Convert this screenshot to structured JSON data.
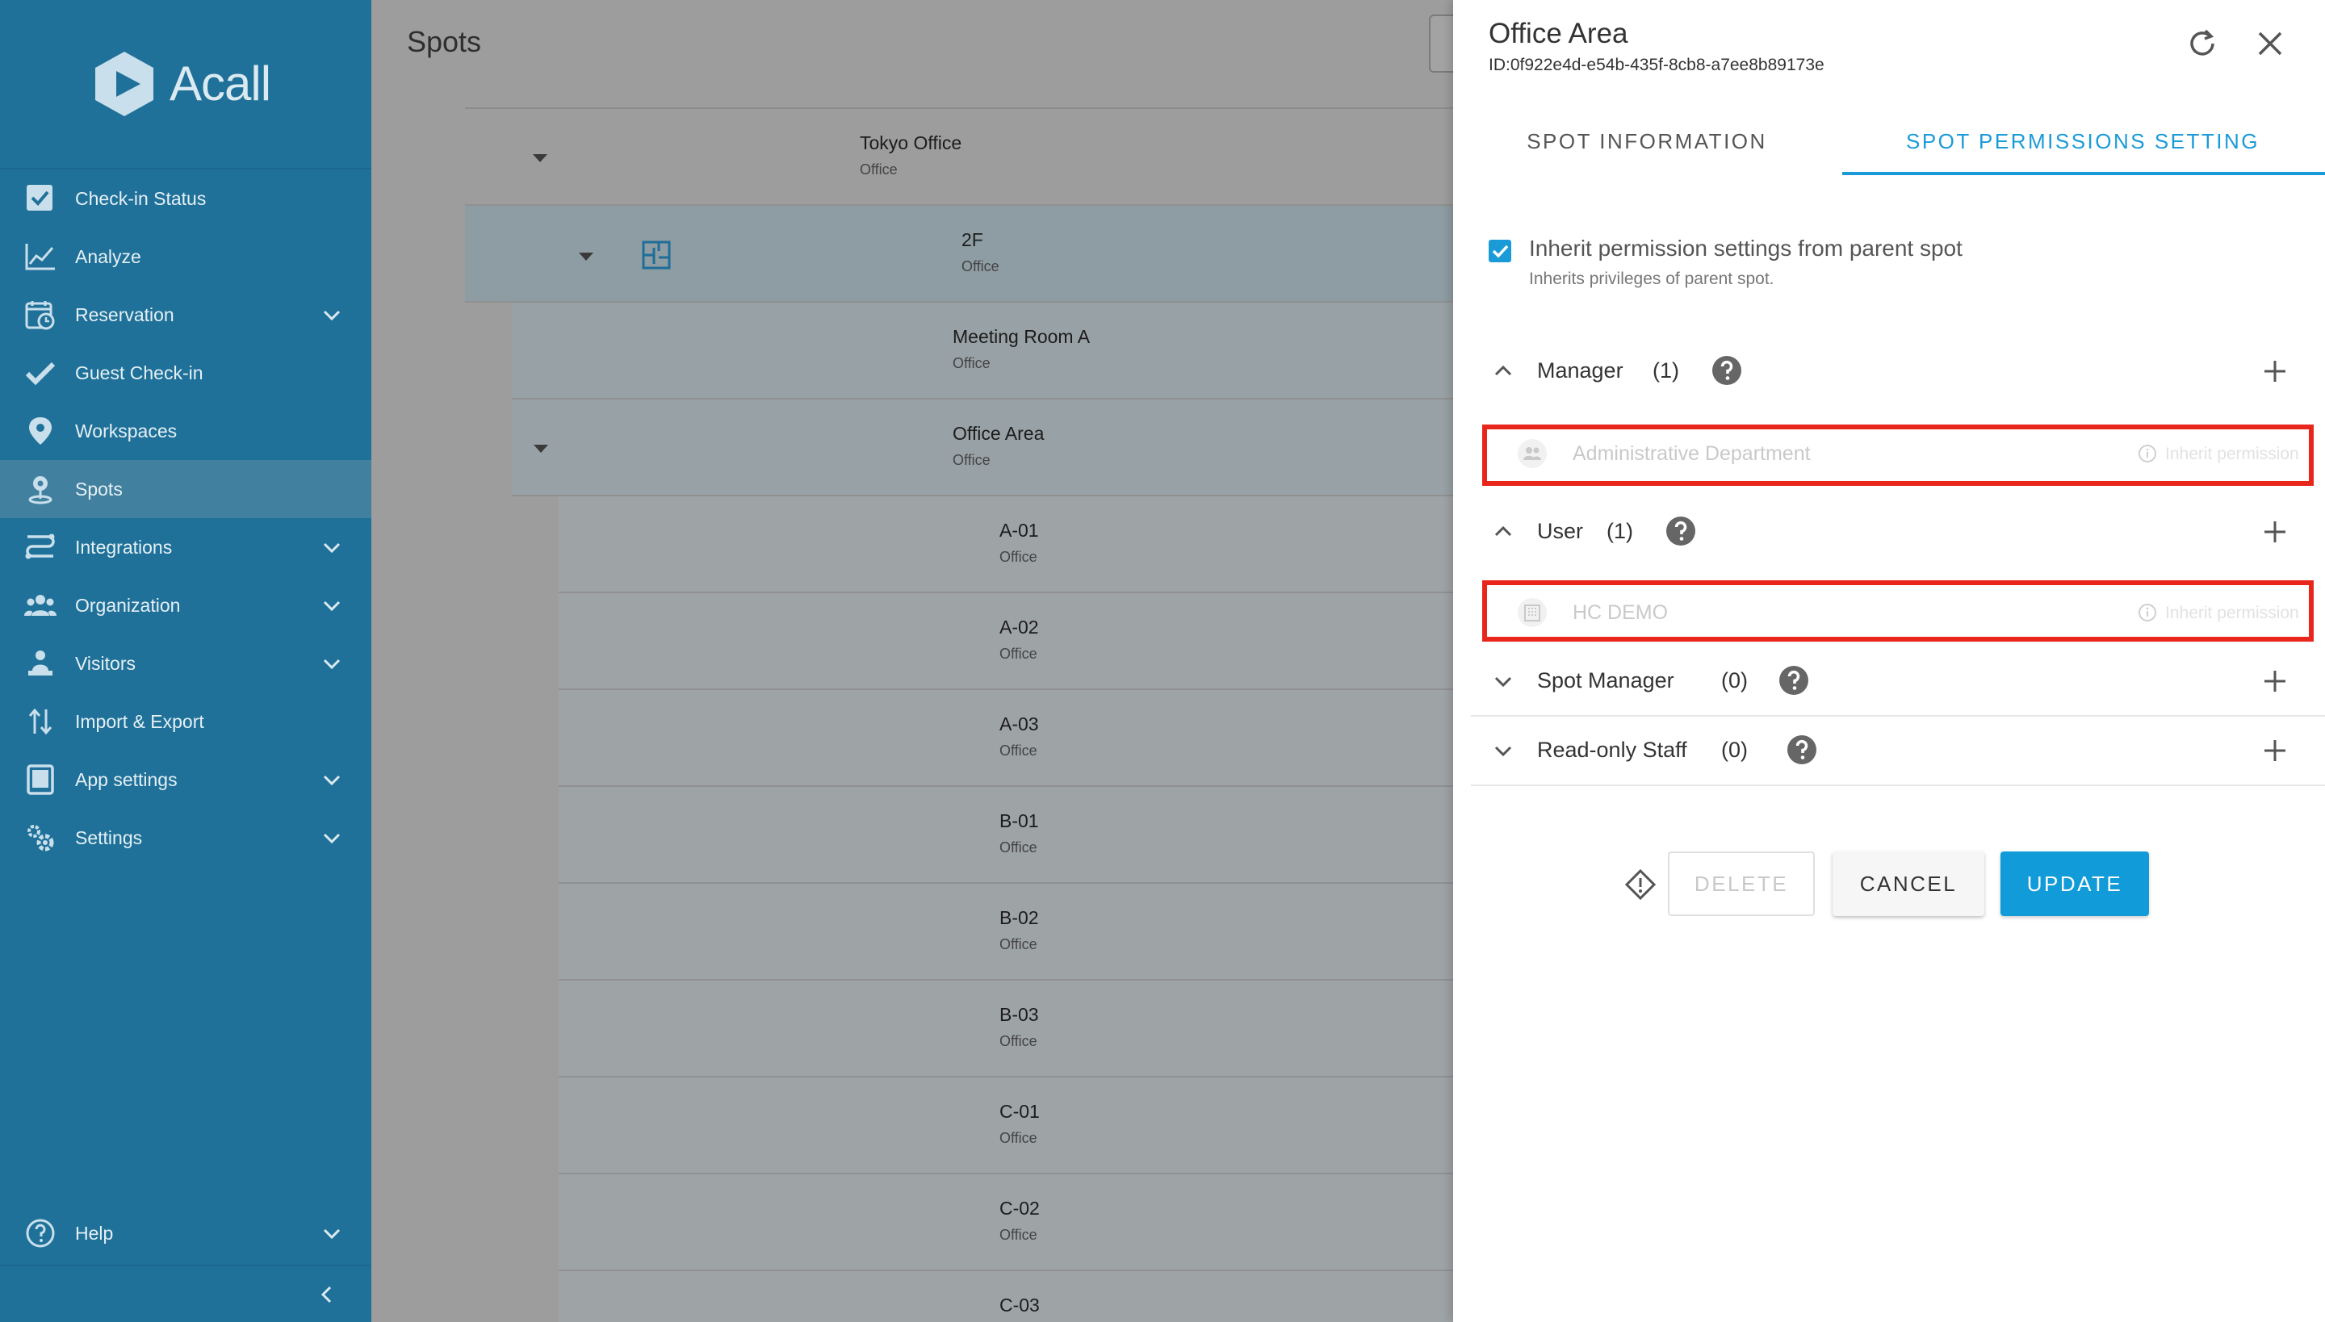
{
  "brand": {
    "name": "Acall"
  },
  "sidebar": {
    "items": [
      {
        "label": "Check-in Status",
        "icon": "check-square-icon",
        "has_submenu": false
      },
      {
        "label": "Analyze",
        "icon": "line-chart-icon",
        "has_submenu": false
      },
      {
        "label": "Reservation",
        "icon": "calendar-clock-icon",
        "has_submenu": true
      },
      {
        "label": "Guest Check-in",
        "icon": "checkmark-icon",
        "has_submenu": false
      },
      {
        "label": "Workspaces",
        "icon": "map-pin-icon",
        "has_submenu": false
      },
      {
        "label": "Spots",
        "icon": "spot-pin-icon",
        "has_submenu": false,
        "active": true
      },
      {
        "label": "Integrations",
        "icon": "integrations-icon",
        "has_submenu": true
      },
      {
        "label": "Organization",
        "icon": "people-group-icon",
        "has_submenu": true
      },
      {
        "label": "Visitors",
        "icon": "visitor-icon",
        "has_submenu": true
      },
      {
        "label": "Import & Export",
        "icon": "import-export-icon",
        "has_submenu": false
      },
      {
        "label": "App settings",
        "icon": "tablet-icon",
        "has_submenu": true
      },
      {
        "label": "Settings",
        "icon": "gears-icon",
        "has_submenu": true
      }
    ],
    "help": {
      "label": "Help",
      "icon": "help-circle-icon"
    }
  },
  "main": {
    "title": "Spots",
    "tree": [
      {
        "name": "Tokyo Office",
        "type": "Office",
        "level": 0,
        "expanded": true
      },
      {
        "name": "2F",
        "type": "Office",
        "level": 1,
        "expanded": true,
        "icon": "floor-plan-icon"
      },
      {
        "name": "Meeting Room A",
        "type": "Office",
        "level": 2
      },
      {
        "name": "Office Area",
        "type": "Office",
        "level": 2,
        "expanded": true
      },
      {
        "name": "A-01",
        "type": "Office",
        "level": 3
      },
      {
        "name": "A-02",
        "type": "Office",
        "level": 3
      },
      {
        "name": "A-03",
        "type": "Office",
        "level": 3
      },
      {
        "name": "B-01",
        "type": "Office",
        "level": 3
      },
      {
        "name": "B-02",
        "type": "Office",
        "level": 3
      },
      {
        "name": "B-03",
        "type": "Office",
        "level": 3
      },
      {
        "name": "C-01",
        "type": "Office",
        "level": 3
      },
      {
        "name": "C-02",
        "type": "Office",
        "level": 3
      },
      {
        "name": "C-03",
        "type": "Office",
        "level": 3
      }
    ]
  },
  "panel": {
    "title": "Office Area",
    "id": "ID:0f922e4d-e54b-435f-8cb8-a7ee8b89173e",
    "tabs": [
      {
        "label": "SPOT INFORMATION",
        "active": false
      },
      {
        "label": "SPOT PERMISSIONS SETTING",
        "active": true
      }
    ],
    "inherit": {
      "checked": true,
      "label": "Inherit permission settings from parent spot",
      "sublabel": "Inherits privileges of parent spot."
    },
    "sections": [
      {
        "name": "Manager",
        "count": "(1)",
        "expanded": true,
        "entries": [
          {
            "name": "Administrative Department",
            "icon": "group-icon",
            "tag": "Inherit permission"
          }
        ]
      },
      {
        "name": "User",
        "count": "(1)",
        "expanded": true,
        "entries": [
          {
            "name": "HC DEMO",
            "icon": "building-icon",
            "tag": "Inherit permission"
          }
        ]
      },
      {
        "name": "Spot Manager",
        "count": "(0)",
        "expanded": false,
        "entries": []
      },
      {
        "name": "Read-only Staff",
        "count": "(0)",
        "expanded": false,
        "entries": []
      }
    ],
    "buttons": {
      "delete": "DELETE",
      "cancel": "CANCEL",
      "update": "UPDATE"
    }
  },
  "colors": {
    "sidebar_bg": "#1f7199",
    "sidebar_active": "#42809f",
    "accent": "#1a9bd8",
    "overlay_main": "#9d9d9d",
    "highlight_box": "#e8261c"
  }
}
